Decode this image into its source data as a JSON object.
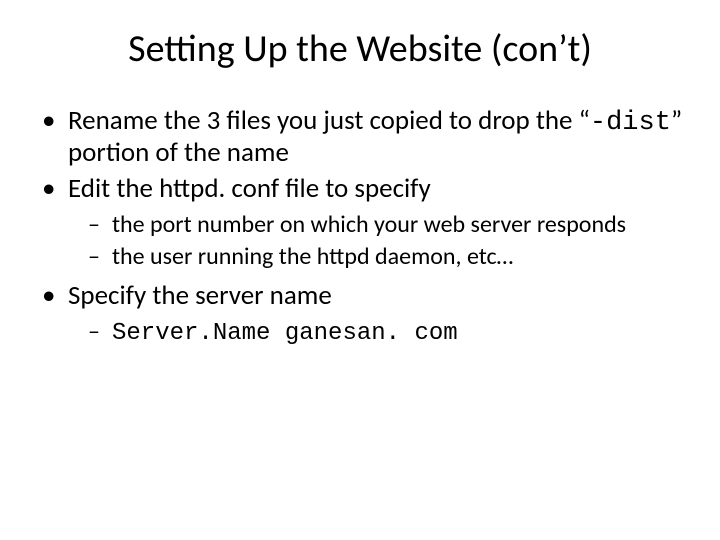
{
  "title": "Setting Up the Website (con’t)",
  "bullets": {
    "b1_pre": "Rename the 3 files you just copied to drop the “",
    "b1_code": "-dist",
    "b1_post": "” portion of the name",
    "b2": "Edit the httpd. conf file to specify",
    "b2_sub1": "the port number on which your web server responds",
    "b2_sub2": "the user running the httpd daemon, etc…",
    "b3": "Specify the server name",
    "b3_sub1": "Server.Name ganesan. com"
  }
}
